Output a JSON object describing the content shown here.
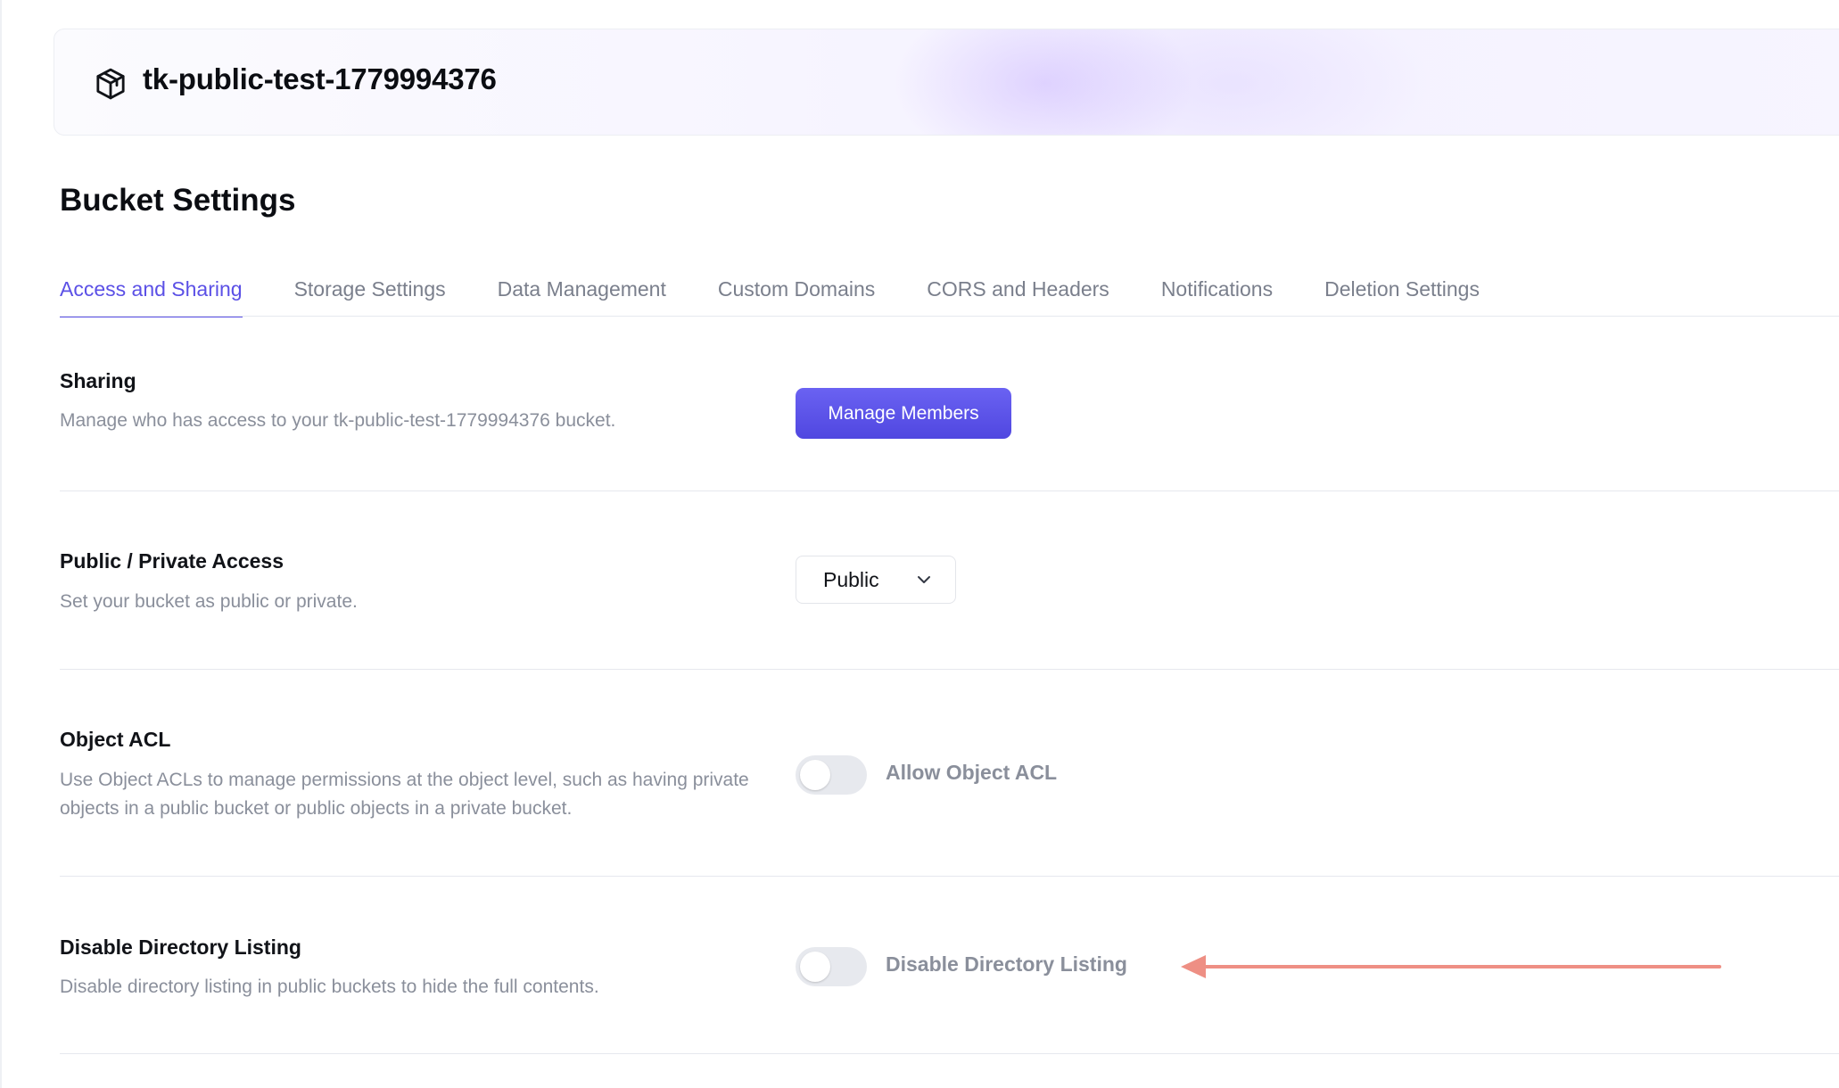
{
  "header": {
    "bucket_name": "tk-public-test-1779994376",
    "icon": "box-icon"
  },
  "page": {
    "title": "Bucket Settings"
  },
  "tabs": [
    {
      "label": "Access and Sharing",
      "active": true
    },
    {
      "label": "Storage Settings",
      "active": false
    },
    {
      "label": "Data Management",
      "active": false
    },
    {
      "label": "Custom Domains",
      "active": false
    },
    {
      "label": "CORS and Headers",
      "active": false
    },
    {
      "label": "Notifications",
      "active": false
    },
    {
      "label": "Deletion Settings",
      "active": false
    }
  ],
  "sections": {
    "sharing": {
      "title": "Sharing",
      "description": "Manage who has access to your tk-public-test-1779994376 bucket.",
      "button_label": "Manage Members"
    },
    "access": {
      "title": "Public / Private Access",
      "description": "Set your bucket as public or private.",
      "selected": "Public"
    },
    "object_acl": {
      "title": "Object ACL",
      "description": "Use Object ACLs to manage permissions at the object level, such as having private objects in a public bucket or public objects in a private bucket.",
      "toggle_label": "Allow Object ACL",
      "enabled": false
    },
    "directory_listing": {
      "title": "Disable Directory Listing",
      "description": "Disable directory listing in public buckets to hide the full contents.",
      "toggle_label": "Disable Directory Listing",
      "enabled": false
    }
  },
  "colors": {
    "accent": "#5b50e6",
    "button": "#5a51ea",
    "annotation_arrow": "#ee8f84",
    "muted_text": "#8a8f9b"
  }
}
